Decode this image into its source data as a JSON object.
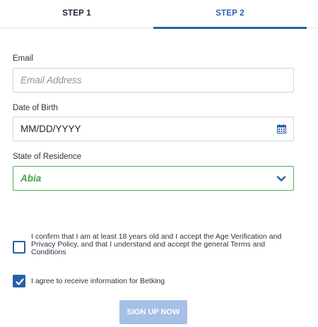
{
  "tabs": [
    {
      "label": "STEP 1",
      "active": false
    },
    {
      "label": "STEP 2",
      "active": true
    }
  ],
  "form": {
    "email": {
      "label": "Email",
      "placeholder": "Email Address"
    },
    "dob": {
      "label": "Date of Birth",
      "value": "MM/DD/YYYY",
      "icon": "calendar-icon"
    },
    "state": {
      "label": "State of Residence",
      "value": "Abia",
      "icon": "chevron-down-icon"
    },
    "age_consent": {
      "checked": false,
      "lines": [
        "I confirm that I am at least 18 years old and I accept the Age Verification and",
        "Privacy Policy, and that I understand and accept the general Terms and",
        "Conditions"
      ]
    },
    "marketing_consent": {
      "checked": true,
      "text": "I agree to receive information for Betking"
    },
    "submit_label": "SIGN UP NOW"
  },
  "colors": {
    "accent": "#2a5fa6",
    "valid_green": "#3da652",
    "button_disabled": "#a6bfe5"
  }
}
